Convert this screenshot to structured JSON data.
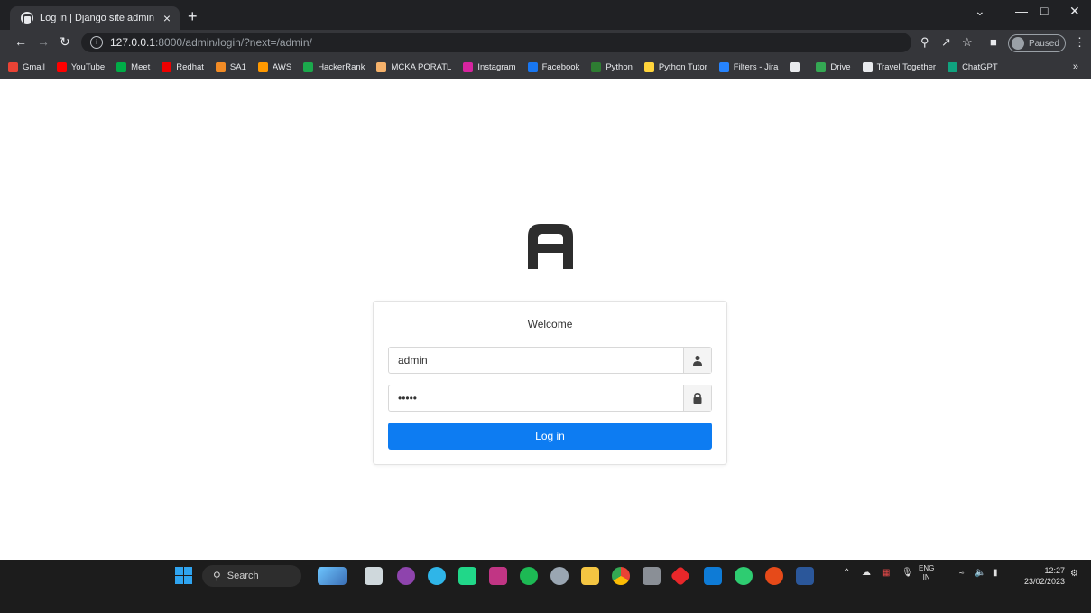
{
  "browser": {
    "tab_title": "Log in | Django site admin",
    "tab_close": "×",
    "new_tab": "+",
    "url_host": "127.0.0.1",
    "url_path": ":8000/admin/login/?next=/admin/",
    "paused_label": "Paused",
    "bookmarks": [
      {
        "label": "Gmail",
        "color": "#ea4335"
      },
      {
        "label": "YouTube",
        "color": "#ff0000"
      },
      {
        "label": "Meet",
        "color": "#00ac47"
      },
      {
        "label": "Redhat",
        "color": "#ee0000"
      },
      {
        "label": "SA1",
        "color": "#f28b25"
      },
      {
        "label": "AWS",
        "color": "#ff9900"
      },
      {
        "label": "HackerRank",
        "color": "#1ba94c"
      },
      {
        "label": "MCKA PORATL",
        "color": "#f6b26b"
      },
      {
        "label": "Instagram",
        "color": "#d6249f"
      },
      {
        "label": "Facebook",
        "color": "#1877f2"
      },
      {
        "label": "Python",
        "color": "#2e7d32"
      },
      {
        "label": "Python Tutor",
        "color": "#ffd43b"
      },
      {
        "label": "Filters - Jira",
        "color": "#2684ff"
      },
      {
        "label": "",
        "color": "#e8eaed"
      },
      {
        "label": "Drive",
        "color": "#34a853"
      },
      {
        "label": "Travel Together",
        "color": "#e8eaed"
      },
      {
        "label": "ChatGPT",
        "color": "#10a37f"
      }
    ],
    "bookmarks_more": "»"
  },
  "login": {
    "welcome": "Welcome",
    "username_value": "admin",
    "password_value": "admin",
    "submit_label": "Log in"
  },
  "taskbar": {
    "search_label": "Search",
    "lang_line1": "ENG",
    "lang_line2": "IN",
    "time": "12:27",
    "date": "23/02/2023"
  },
  "colors": {
    "primary_button": "#0d7cf2",
    "taskbar_bg": "#1c1c1c",
    "chrome_bg": "#202124"
  }
}
